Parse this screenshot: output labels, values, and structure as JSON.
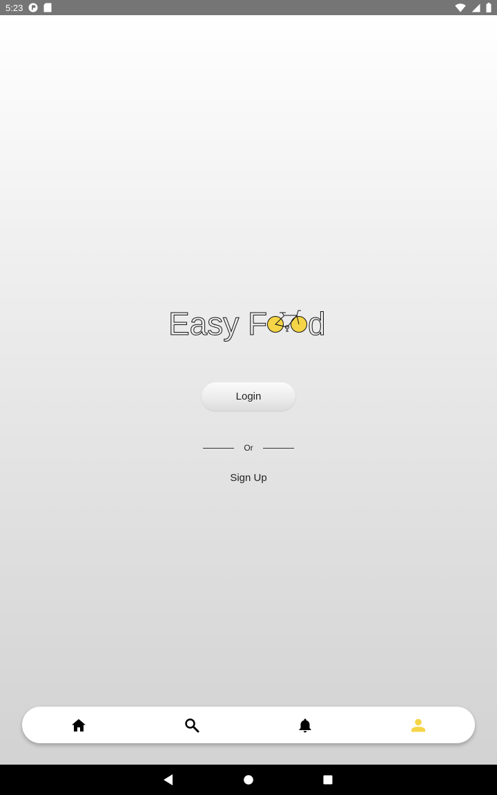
{
  "status_bar": {
    "time": "5:23",
    "icons_left": [
      "app-notification-icon",
      "sd-card-icon"
    ],
    "icons_right": [
      "wifi-icon",
      "signal-icon",
      "battery-icon"
    ]
  },
  "logo": {
    "text_part1": "Easy F",
    "text_part2": "d",
    "wheel_color": "#f5d547"
  },
  "auth": {
    "login_label": "Login",
    "or_label": "Or",
    "signup_label": "Sign Up"
  },
  "bottom_nav": {
    "items": [
      {
        "name": "home",
        "icon": "home-icon",
        "color": "#000000"
      },
      {
        "name": "search",
        "icon": "search-icon",
        "color": "#000000"
      },
      {
        "name": "notifications",
        "icon": "bell-icon",
        "color": "#000000"
      },
      {
        "name": "profile",
        "icon": "person-icon",
        "color": "#f5d547",
        "selected": true
      }
    ]
  },
  "system_nav": {
    "buttons": [
      "back-icon",
      "home-circle-icon",
      "recents-icon"
    ]
  },
  "colors": {
    "accent": "#f5d547",
    "status_bar_bg": "#757575",
    "system_nav_bg": "#000000"
  }
}
